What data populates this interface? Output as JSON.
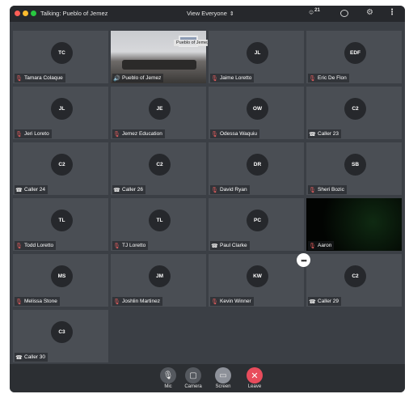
{
  "window": {
    "title": "Talking: Pueblo of Jemez",
    "view_label": "View Everyone",
    "participant_count": "21"
  },
  "tiles": [
    {
      "initials": "TC",
      "name": "Tamara Colaque",
      "status": "muted"
    },
    {
      "initials": "",
      "name": "Pueblo of Jemez",
      "status": "speaking",
      "video": "Pueblo of Jemez"
    },
    {
      "initials": "JL",
      "name": "Jaime Loretto",
      "status": "muted"
    },
    {
      "initials": "EDF",
      "name": "Eric De Flon",
      "status": "muted"
    },
    {
      "initials": "JL",
      "name": "Jeri Loreto",
      "status": "muted"
    },
    {
      "initials": "JE",
      "name": "Jemez Education",
      "status": "muted"
    },
    {
      "initials": "OW",
      "name": "Odessa Waquiu",
      "status": "muted"
    },
    {
      "initials": "C2",
      "name": "Caller 23",
      "status": "phone"
    },
    {
      "initials": "C2",
      "name": "Caller 24",
      "status": "phone"
    },
    {
      "initials": "C2",
      "name": "Caller 26",
      "status": "phone"
    },
    {
      "initials": "DR",
      "name": "David Ryan",
      "status": "muted"
    },
    {
      "initials": "SB",
      "name": "Sheri Bozic",
      "status": "muted"
    },
    {
      "initials": "TL",
      "name": "Todd Loretto",
      "status": "muted"
    },
    {
      "initials": "TL",
      "name": "TJ Loretto",
      "status": "muted"
    },
    {
      "initials": "PC",
      "name": "Paul Clarke",
      "status": "phone"
    },
    {
      "initials": "",
      "name": "Aaron",
      "status": "muted",
      "video": "dark"
    },
    {
      "initials": "MS",
      "name": "Melissa Stone",
      "status": "muted"
    },
    {
      "initials": "JM",
      "name": "Joshlin Martinez",
      "status": "muted"
    },
    {
      "initials": "KW",
      "name": "Kevin Winner",
      "status": "muted"
    },
    {
      "initials": "C2",
      "name": "Caller 29",
      "status": "phone"
    },
    {
      "initials": "C3",
      "name": "Caller 30",
      "status": "phone"
    }
  ],
  "toolbar": {
    "mic_label": "Mic",
    "camera_label": "Camera",
    "screen_label": "Screen",
    "leave_label": "Leave"
  },
  "icons": {
    "muted": "mic-muted-icon",
    "phone": "phone-icon",
    "speaking": "speaker-icon"
  },
  "colors": {
    "leave": "#e84c5c",
    "muted": "#e05c5c",
    "speaking": "#4cd964"
  }
}
